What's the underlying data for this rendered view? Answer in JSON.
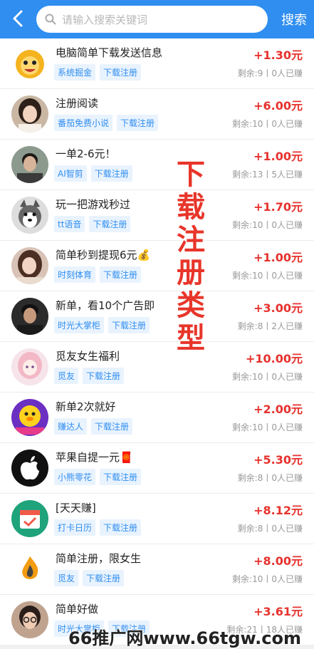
{
  "header": {
    "search_placeholder": "请输入搜索关键词",
    "search_button": "搜索"
  },
  "tasks": [
    {
      "title": "电脑简单下载发送信息",
      "tags": [
        "系统掘金",
        "下载注册"
      ],
      "reward": "+1.30元",
      "stats": "剩余:9丨0人已赚",
      "avatar": "cartoon-lion-avatar"
    },
    {
      "title": "注册阅读",
      "tags": [
        "番茄免费小说",
        "下载注册"
      ],
      "reward": "+6.00元",
      "stats": "剩余:10丨0人已赚",
      "avatar": "girl-photo-avatar"
    },
    {
      "title": "一单2-6元！",
      "tags": [
        "AI智剪",
        "下载注册"
      ],
      "reward": "+1.00元",
      "stats": "剩余:13丨5人已赚",
      "avatar": "man-photo-avatar"
    },
    {
      "title": "玩一把游戏秒过",
      "tags": [
        "tt语音",
        "下载注册"
      ],
      "reward": "+1.70元",
      "stats": "剩余:10丨0人已赚",
      "avatar": "husky-dog-avatar"
    },
    {
      "title": "简单秒到提现6元💰",
      "tags": [
        "时刻体育",
        "下载注册"
      ],
      "reward": "+1.00元",
      "stats": "剩余:10丨0人已赚",
      "avatar": "woman-photo-avatar"
    },
    {
      "title": "新单，看10个广告即",
      "tags": [
        "时光大掌柜",
        "下载注册"
      ],
      "reward": "+3.00元",
      "stats": "剩余:8丨2人已赚",
      "avatar": "man-dark-avatar"
    },
    {
      "title": "觅友女生福利",
      "tags": [
        "觅友",
        "下载注册"
      ],
      "reward": "+10.00元",
      "stats": "剩余:10丨0人已赚",
      "avatar": "anime-girl-avatar"
    },
    {
      "title": "新单2次就好",
      "tags": [
        "赚达人",
        "下载注册"
      ],
      "reward": "+2.00元",
      "stats": "剩余:10丨0人已赚",
      "avatar": "yellow-duck-avatar"
    },
    {
      "title": "苹果自提一元🧧",
      "tags": [
        "小熊零花",
        "下载注册"
      ],
      "reward": "+5.30元",
      "stats": "剩余:8丨0人已赚",
      "avatar": "apple-logo-avatar"
    },
    {
      "title": "[天天赚]",
      "tags": [
        "打卡日历",
        "下载注册"
      ],
      "reward": "+8.12元",
      "stats": "剩余:8丨0人已赚",
      "avatar": "calendar-app-avatar"
    },
    {
      "title": "简单注册，限女生",
      "tags": [
        "觅友",
        "下载注册"
      ],
      "reward": "+8.00元",
      "stats": "剩余:10丨0人已赚",
      "avatar": "flame-logo-avatar"
    },
    {
      "title": "简单好做",
      "tags": [
        "时光大掌柜",
        "下载注册"
      ],
      "reward": "+3.61元",
      "stats": "剩余:21丨18人已赚",
      "avatar": "woman-glasses-avatar"
    }
  ],
  "overlay_text": "下载注册类型",
  "watermark": "66推广网www.66tgw.com",
  "colors": {
    "primary": "#2f8ef0",
    "reward": "#e6322e",
    "overlay": "#e8352a"
  }
}
